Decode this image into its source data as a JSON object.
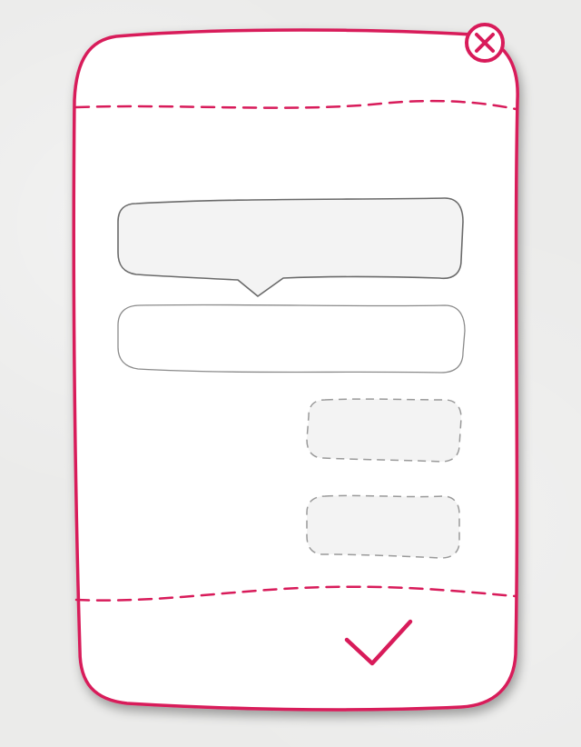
{
  "colors": {
    "accent": "#d81b5a",
    "background": "#ebebea",
    "card": "#ffffff",
    "element_fill": "#f3f3f3",
    "element_stroke": "#6a6a6a",
    "dashed_stroke": "#9a9a9a"
  },
  "icons": {
    "close": "close-icon",
    "confirm": "checkmark-icon"
  }
}
